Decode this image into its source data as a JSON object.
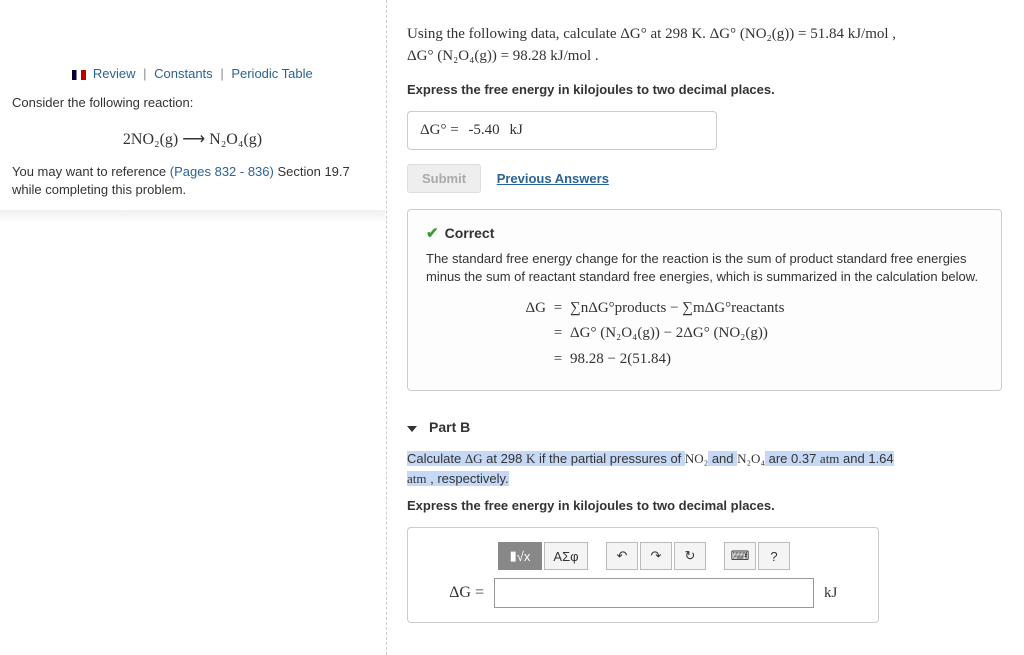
{
  "sidebar": {
    "nav": {
      "review": "Review",
      "constants": "Constants",
      "periodic": "Periodic Table"
    },
    "consider": "Consider the following reaction:",
    "equation": "2NO₂(g)  ⟶  N₂O₄(g)",
    "ref_a": "You may want to reference ",
    "ref_pages": "(Pages 832 - 836)",
    "ref_b": " Section 19.7 while completing this problem."
  },
  "partA": {
    "intro_a": "Using the following data, calculate ΔG° at 298 K. ΔG° (NO₂(g)) = 51.84 kJ/mol ,",
    "intro_b": "ΔG° (N₂O₄(g)) = 98.28 kJ/mol .",
    "instruct": "Express the free energy in kilojoules to two decimal places.",
    "answer_label": "ΔG° =",
    "answer_value": "-5.40",
    "answer_unit": "kJ",
    "submit": "Submit",
    "prev": "Previous Answers",
    "correct": "Correct",
    "explain": "The standard free energy change for the reaction is the sum of product standard free energies minus the sum of reactant standard free energies, which is summarized in the calculation below.",
    "eq1_lhs": "ΔG",
    "eq1": "∑nΔG°products − ∑mΔG°reactants",
    "eq2": "ΔG° (N₂O₄(g)) − 2ΔG° (NO₂(g))",
    "eq3": "98.28 − 2(51.84)"
  },
  "partB": {
    "title": "Part B",
    "q_a": "Calculate ",
    "q_dg": "ΔG",
    "q_b": " at 298 ",
    "q_k": "K",
    "q_c": " if the partial pressures of ",
    "q_no2": "NO₂",
    "q_d": " and ",
    "q_n2o4": "N₂O₄",
    "q_e": " are 0.37 ",
    "q_atm1": "atm",
    "q_f": " and 1.64 ",
    "q_atm2": "atm",
    "q_g": " , respectively.",
    "instruct": "Express the free energy in kilojoules to two decimal places.",
    "toolbar": {
      "templates": "√x",
      "symbols": "ΑΣφ",
      "undo": "↶",
      "redo": "↷",
      "reset": "↻",
      "keyboard": "⌨",
      "help": "?"
    },
    "label": "ΔG =",
    "unit": "kJ"
  }
}
